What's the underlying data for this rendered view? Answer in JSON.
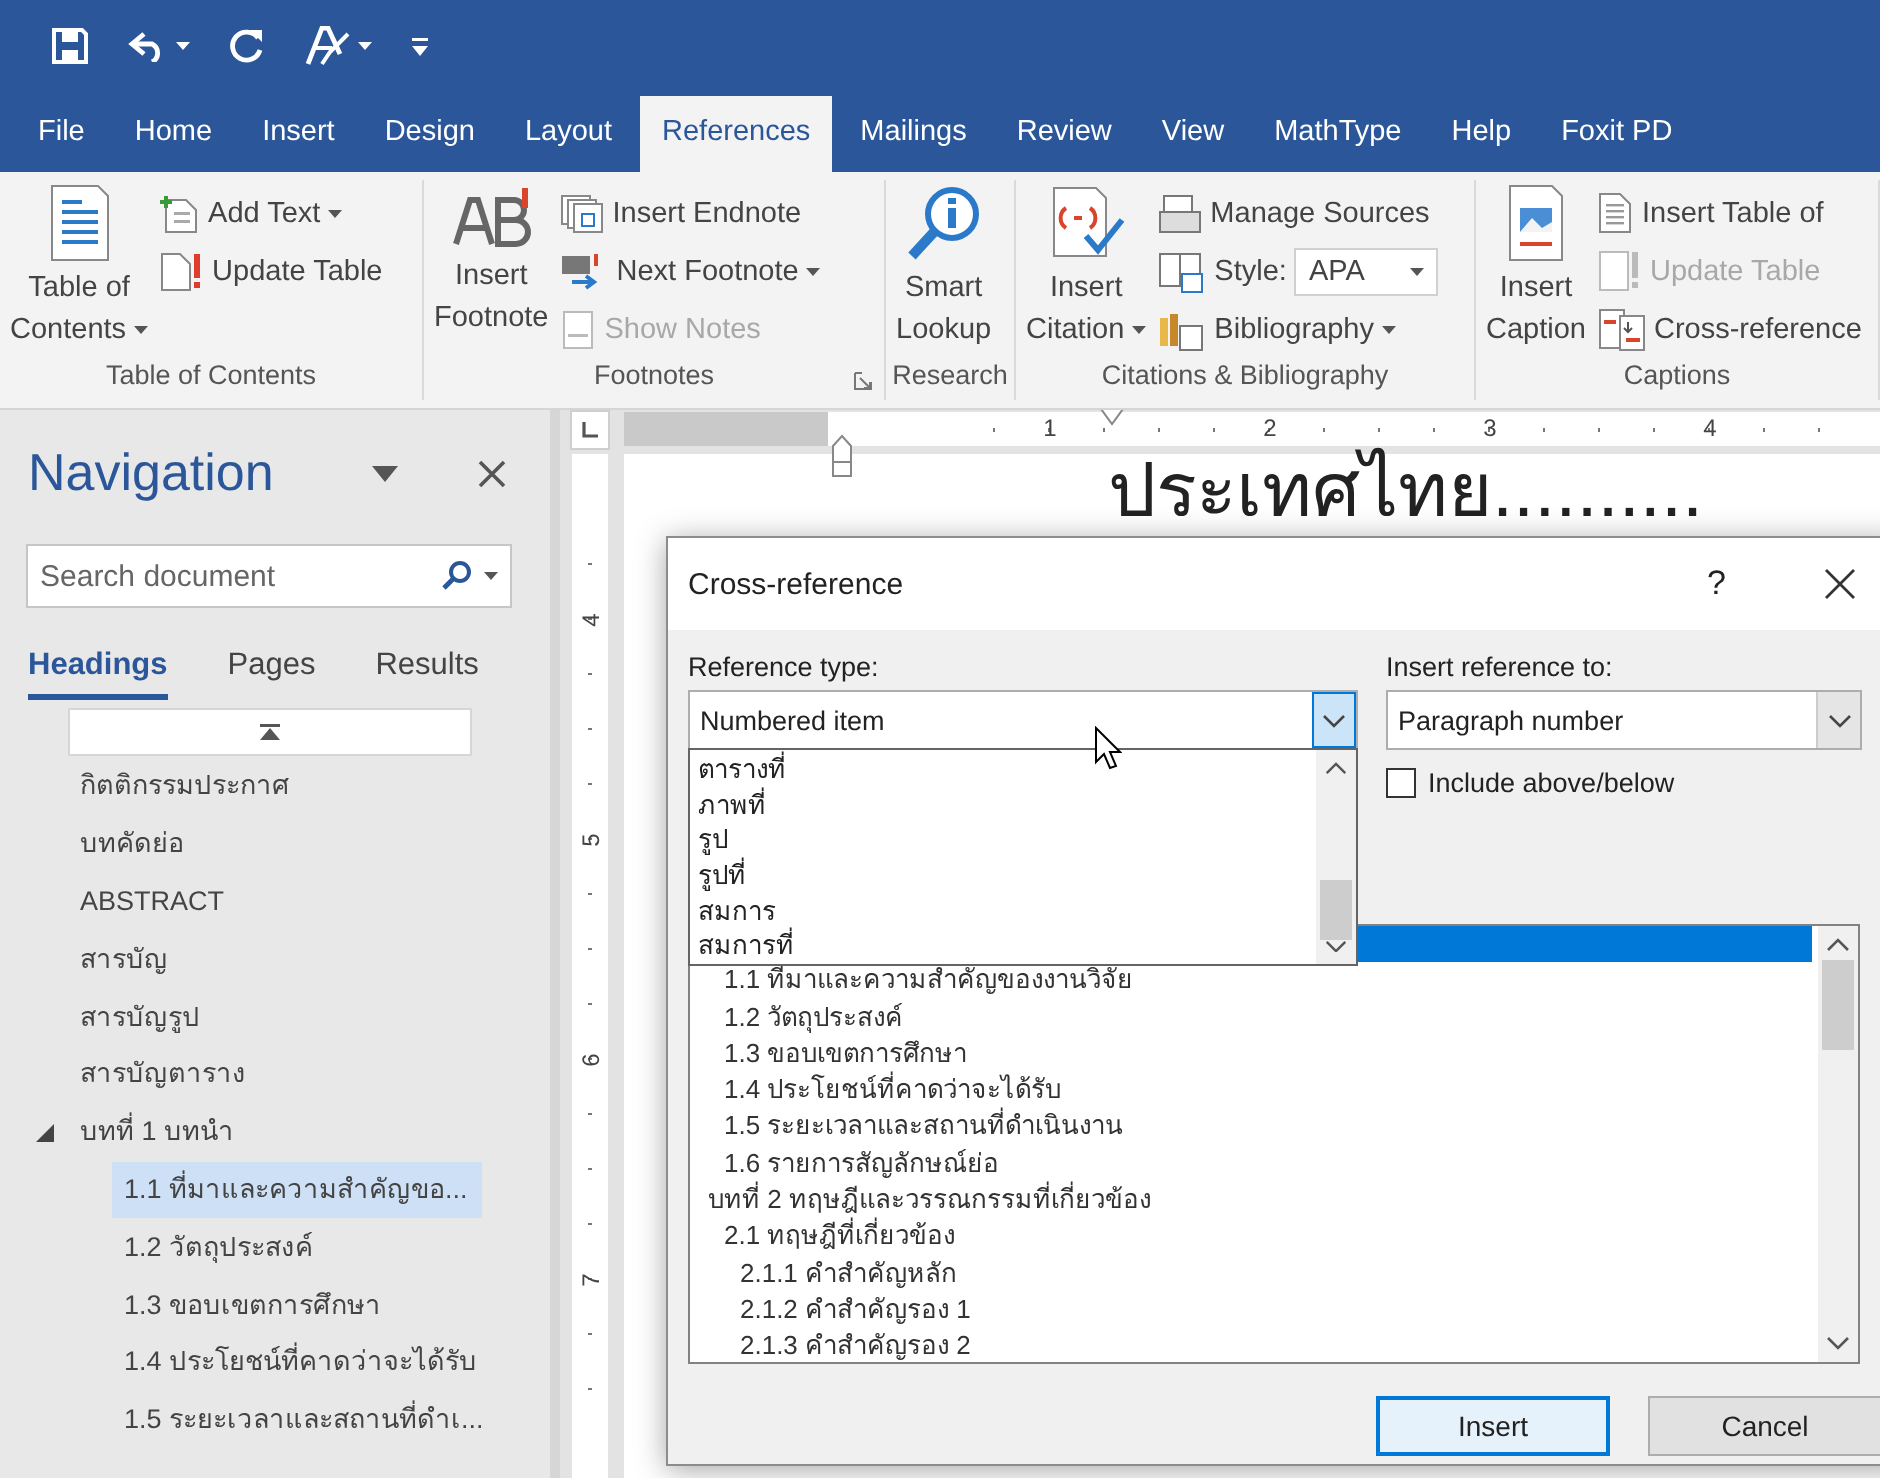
{
  "tabs": [
    {
      "label": "File",
      "selected": false
    },
    {
      "label": "Home",
      "selected": false
    },
    {
      "label": "Insert",
      "selected": false
    },
    {
      "label": "Design",
      "selected": false
    },
    {
      "label": "Layout",
      "selected": false
    },
    {
      "label": "References",
      "selected": true
    },
    {
      "label": "Mailings",
      "selected": false
    },
    {
      "label": "Review",
      "selected": false
    },
    {
      "label": "View",
      "selected": false
    },
    {
      "label": "MathType",
      "selected": false
    },
    {
      "label": "Help",
      "selected": false
    },
    {
      "label": "Foxit PD",
      "selected": false
    }
  ],
  "ribbon": {
    "groups": [
      {
        "label": "Table of Contents",
        "launcher": false,
        "items": [
          {
            "kind": "large",
            "lines": [
              "Table of",
              "Contents"
            ],
            "dropdown": true,
            "disabled": false
          },
          {
            "kind": "small",
            "label": "Add Text",
            "dropdown": true,
            "disabled": false
          },
          {
            "kind": "small",
            "label": "Update Table",
            "dropdown": false,
            "disabled": false
          }
        ]
      },
      {
        "label": "Footnotes",
        "launcher": true,
        "items": [
          {
            "kind": "large",
            "lines": [
              "Insert",
              "Footnote"
            ],
            "dropdown": false,
            "disabled": false
          },
          {
            "kind": "small",
            "label": "Insert Endnote",
            "dropdown": false,
            "disabled": false
          },
          {
            "kind": "small",
            "label": "Next Footnote",
            "dropdown": true,
            "disabled": false
          },
          {
            "kind": "small",
            "label": "Show Notes",
            "dropdown": false,
            "disabled": true
          }
        ]
      },
      {
        "label": "Research",
        "launcher": false,
        "items": [
          {
            "kind": "large",
            "lines": [
              "Smart",
              "Lookup"
            ],
            "dropdown": false,
            "disabled": false
          }
        ]
      },
      {
        "label": "Citations & Bibliography",
        "launcher": false,
        "items": [
          {
            "kind": "large",
            "lines": [
              "Insert",
              "Citation"
            ],
            "dropdown": true,
            "disabled": false
          },
          {
            "kind": "small",
            "label": "Manage Sources",
            "dropdown": false,
            "disabled": false
          },
          {
            "kind": "combo",
            "label": "Style:",
            "value": "APA",
            "dropdown": true,
            "disabled": false
          },
          {
            "kind": "small",
            "label": "Bibliography",
            "dropdown": true,
            "disabled": false
          }
        ]
      },
      {
        "label": "Captions",
        "launcher": false,
        "items": [
          {
            "kind": "large",
            "lines": [
              "Insert",
              "Caption"
            ],
            "dropdown": false,
            "disabled": false
          },
          {
            "kind": "small",
            "label": "Insert Table of",
            "dropdown": false,
            "disabled": false
          },
          {
            "kind": "small",
            "label": "Update Table",
            "dropdown": false,
            "disabled": true
          },
          {
            "kind": "small",
            "label": "Cross-reference",
            "dropdown": false,
            "disabled": false
          }
        ]
      }
    ]
  },
  "navigation": {
    "title": "Navigation",
    "search": {
      "placeholder": "Search document"
    },
    "tabs": [
      {
        "label": "Headings",
        "selected": true
      },
      {
        "label": "Pages",
        "selected": false
      },
      {
        "label": "Results",
        "selected": false
      }
    ],
    "headings": [
      {
        "label": "กิตติกรรมประกาศ",
        "selected": false
      },
      {
        "label": "บทคัดย่อ",
        "selected": false
      },
      {
        "label": "ABSTRACT",
        "selected": false
      },
      {
        "label": "สารบัญ",
        "selected": false
      },
      {
        "label": "สารบัญรูป",
        "selected": false
      },
      {
        "label": "สารบัญตาราง",
        "selected": false
      },
      {
        "label": "บทที่ 1  บทนำ",
        "selected": false,
        "expanded": true,
        "children": [
          {
            "label": "1.1 ที่มาและความสำคัญขอ...",
            "selected": true
          },
          {
            "label": "1.2 วัตถุประสงค์",
            "selected": false
          },
          {
            "label": "1.3 ขอบเขตการศึกษา",
            "selected": false
          },
          {
            "label": "1.4 ประโยชน์ที่คาดว่าจะได้รับ",
            "selected": false
          },
          {
            "label": "1.5 ระยะเวลาและสถานที่ดำเ...",
            "selected": false
          }
        ]
      }
    ]
  },
  "document": {
    "ruler": {
      "horizontal": [
        "1",
        "2",
        "3",
        "4"
      ],
      "vertical": [
        "4",
        "5",
        "6",
        "7"
      ]
    },
    "heading": "ประเทศไทย.........."
  },
  "dialog": {
    "title": "Cross-reference",
    "help": "?",
    "reference_type": {
      "label": "Reference type:",
      "value": "Numbered item",
      "expanded": true,
      "options": [
        {
          "label": "ตารางที่",
          "selected": false
        },
        {
          "label": "ภาพที่",
          "selected": false
        },
        {
          "label": "รูป",
          "selected": false
        },
        {
          "label": "รูปที่",
          "selected": false
        },
        {
          "label": "สมการ",
          "selected": false
        },
        {
          "label": "สมการที่",
          "selected": false
        }
      ]
    },
    "insert_reference_to": {
      "label": "Insert reference to:",
      "value": "Paragraph number"
    },
    "include_above_below": {
      "label": "Include above/below",
      "checked": false
    },
    "items": [
      {
        "selected": true,
        "children": [
          {
            "label": "1.1 ที่มาและความสำคัญของงานวิจัย",
            "selected": false
          },
          {
            "label": "1.2 วัตถุประสงค์",
            "selected": false
          },
          {
            "label": "1.3 ขอบเขตการศึกษา",
            "selected": false
          },
          {
            "label": "1.4 ประโยชน์ที่คาดว่าจะได้รับ",
            "selected": false
          },
          {
            "label": "1.5 ระยะเวลาและสถานที่ดำเนินงาน",
            "selected": false
          },
          {
            "label": "1.6 รายการสัญลักษณ์ย่อ",
            "selected": false
          }
        ]
      },
      {
        "label": "บทที่ 2 ทฤษฎีและวรรณกรรมที่เกี่ยวข้อง",
        "selected": false,
        "children": [
          {
            "label": "2.1 ทฤษฎีที่เกี่ยวข้อง",
            "selected": false,
            "children": [
              {
                "label": "2.1.1 คำสำคัญหลัก",
                "selected": false
              },
              {
                "label": "2.1.2 คำสำคัญรอง 1",
                "selected": false
              },
              {
                "label": "2.1.3 คำสำคัญรอง 2",
                "selected": false
              }
            ]
          }
        ]
      }
    ],
    "buttons": [
      {
        "label": "Insert",
        "default": true
      },
      {
        "label": "Cancel",
        "default": false
      }
    ]
  }
}
